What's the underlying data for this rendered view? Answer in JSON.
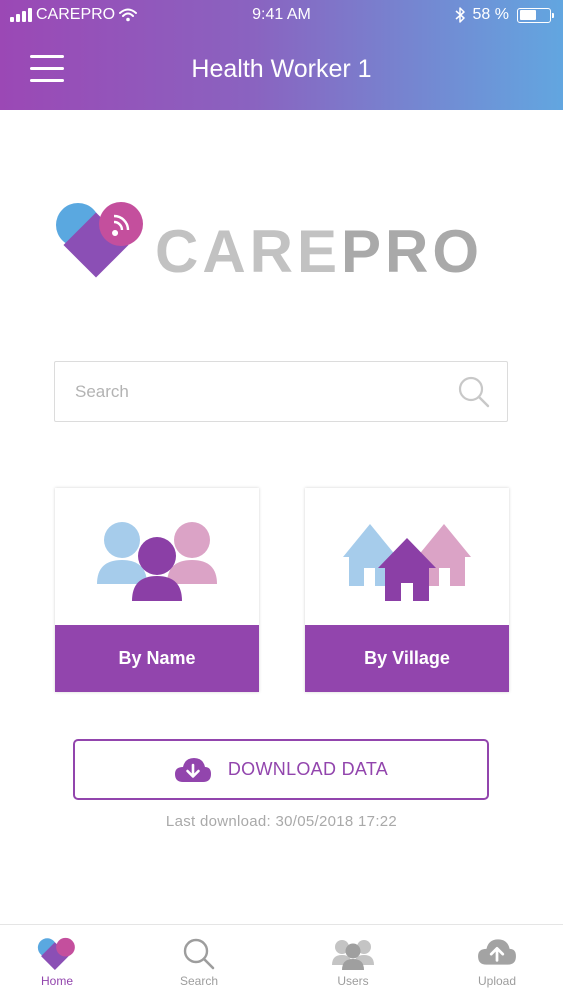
{
  "status_bar": {
    "carrier": "CAREPRO",
    "time": "9:41 AM",
    "battery": "58 %",
    "battery_level": 0.58
  },
  "header": {
    "title": "Health Worker 1"
  },
  "logo": {
    "text_care": "CARE",
    "text_pro": "PRO"
  },
  "search": {
    "placeholder": "Search",
    "value": ""
  },
  "cards": {
    "by_name": "By Name",
    "by_village": "By Village"
  },
  "download": {
    "label": "DOWNLOAD DATA",
    "last": "Last download: 30/05/2018 17:22"
  },
  "nav": {
    "items": [
      {
        "label": "Home",
        "icon": "heart-logo-icon",
        "active": true
      },
      {
        "label": "Search",
        "icon": "search-icon"
      },
      {
        "label": "Users",
        "icon": "users-icon"
      },
      {
        "label": "Upload",
        "icon": "cloud-upload-icon"
      }
    ]
  },
  "colors": {
    "primary_purple": "#9245ad",
    "gradient_start": "#9b48b5",
    "gradient_end": "#62a6e0",
    "light_blue": "#9fc9ec",
    "pink": "#d89ec4",
    "logo_gray": "#b5b5b5"
  }
}
